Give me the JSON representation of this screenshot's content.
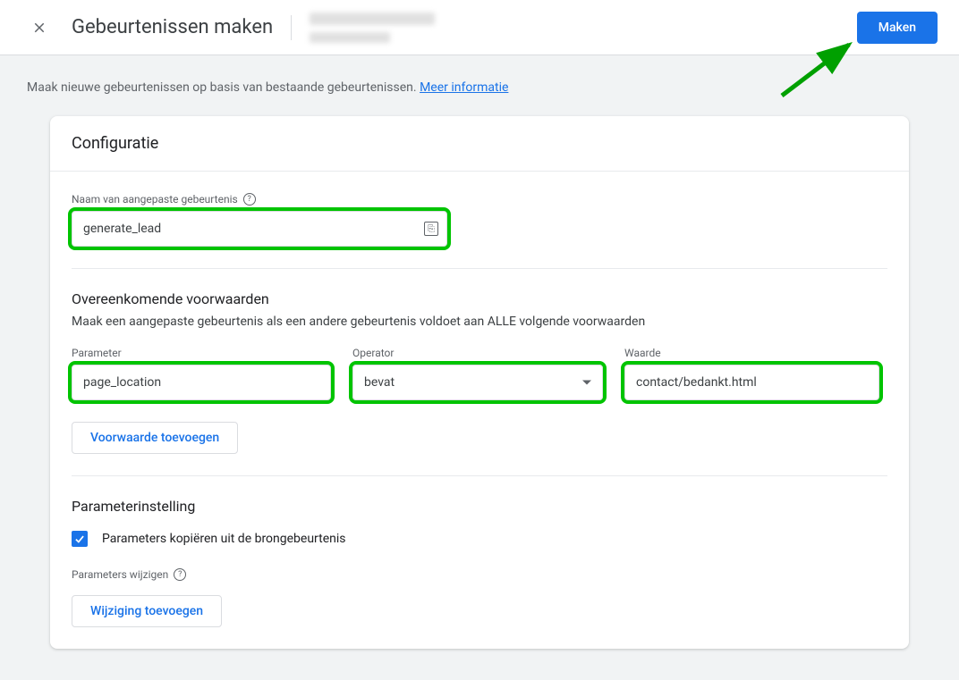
{
  "header": {
    "title": "Gebeurtenissen maken",
    "primary_button": "Maken"
  },
  "intro": {
    "text": "Maak nieuwe gebeurtenissen op basis van bestaande gebeurtenissen.",
    "link": "Meer informatie"
  },
  "config": {
    "title": "Configuratie",
    "name_label": "Naam van aangepaste gebeurtenis",
    "name_value": "generate_lead",
    "conditions": {
      "title": "Overeenkomende voorwaarden",
      "subtitle": "Maak een aangepaste gebeurtenis als een andere gebeurtenis voldoet aan ALLE volgende voorwaarden",
      "labels": {
        "parameter": "Parameter",
        "operator": "Operator",
        "value": "Waarde"
      },
      "row": {
        "parameter": "page_location",
        "operator": "bevat",
        "value": "contact/bedankt.html"
      },
      "add_button": "Voorwaarde toevoegen"
    },
    "params": {
      "title": "Parameterinstelling",
      "copy_label": "Parameters kopiëren uit de brongebeurtenis",
      "modify_label": "Parameters wijzigen",
      "add_mod_button": "Wijziging toevoegen"
    }
  }
}
